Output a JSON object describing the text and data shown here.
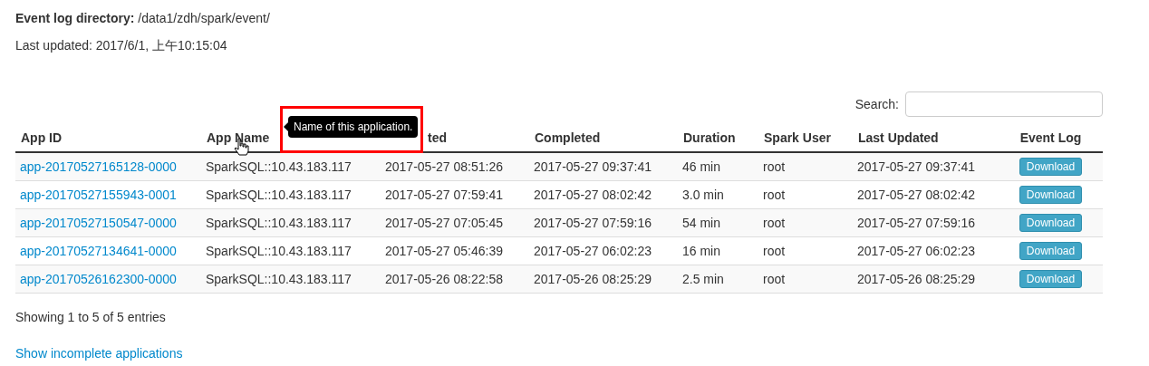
{
  "event_log_directory": {
    "label": "Event log directory:",
    "value": "/data1/zdh/spark/event/"
  },
  "last_updated": "Last updated: 2017/6/1, 上午10:15:04",
  "search": {
    "label": "Search:"
  },
  "table": {
    "columns": [
      "App ID",
      "App Name",
      "ted",
      "Completed",
      "Duration",
      "Spark User",
      "Last Updated",
      "Event Log"
    ],
    "rows": [
      {
        "app_id": "app-20170527165128-0000",
        "app_name": "SparkSQL::10.43.183.117",
        "started": "2017-05-27 08:51:26",
        "completed": "2017-05-27 09:37:41",
        "duration": "46 min",
        "user": "root",
        "last_updated": "2017-05-27 09:37:41",
        "event_log": "Download"
      },
      {
        "app_id": "app-20170527155943-0001",
        "app_name": "SparkSQL::10.43.183.117",
        "started": "2017-05-27 07:59:41",
        "completed": "2017-05-27 08:02:42",
        "duration": "3.0 min",
        "user": "root",
        "last_updated": "2017-05-27 08:02:42",
        "event_log": "Download"
      },
      {
        "app_id": "app-20170527150547-0000",
        "app_name": "SparkSQL::10.43.183.117",
        "started": "2017-05-27 07:05:45",
        "completed": "2017-05-27 07:59:16",
        "duration": "54 min",
        "user": "root",
        "last_updated": "2017-05-27 07:59:16",
        "event_log": "Download"
      },
      {
        "app_id": "app-20170527134641-0000",
        "app_name": "SparkSQL::10.43.183.117",
        "started": "2017-05-27 05:46:39",
        "completed": "2017-05-27 06:02:23",
        "duration": "16 min",
        "user": "root",
        "last_updated": "2017-05-27 06:02:23",
        "event_log": "Download"
      },
      {
        "app_id": "app-20170526162300-0000",
        "app_name": "SparkSQL::10.43.183.117",
        "started": "2017-05-26 08:22:58",
        "completed": "2017-05-26 08:25:29",
        "duration": "2.5 min",
        "user": "root",
        "last_updated": "2017-05-26 08:25:29",
        "event_log": "Download"
      }
    ]
  },
  "tooltip": "Name of this application.",
  "entries_info": "Showing 1 to 5 of 5 entries",
  "incomplete_link": "Show incomplete applications"
}
